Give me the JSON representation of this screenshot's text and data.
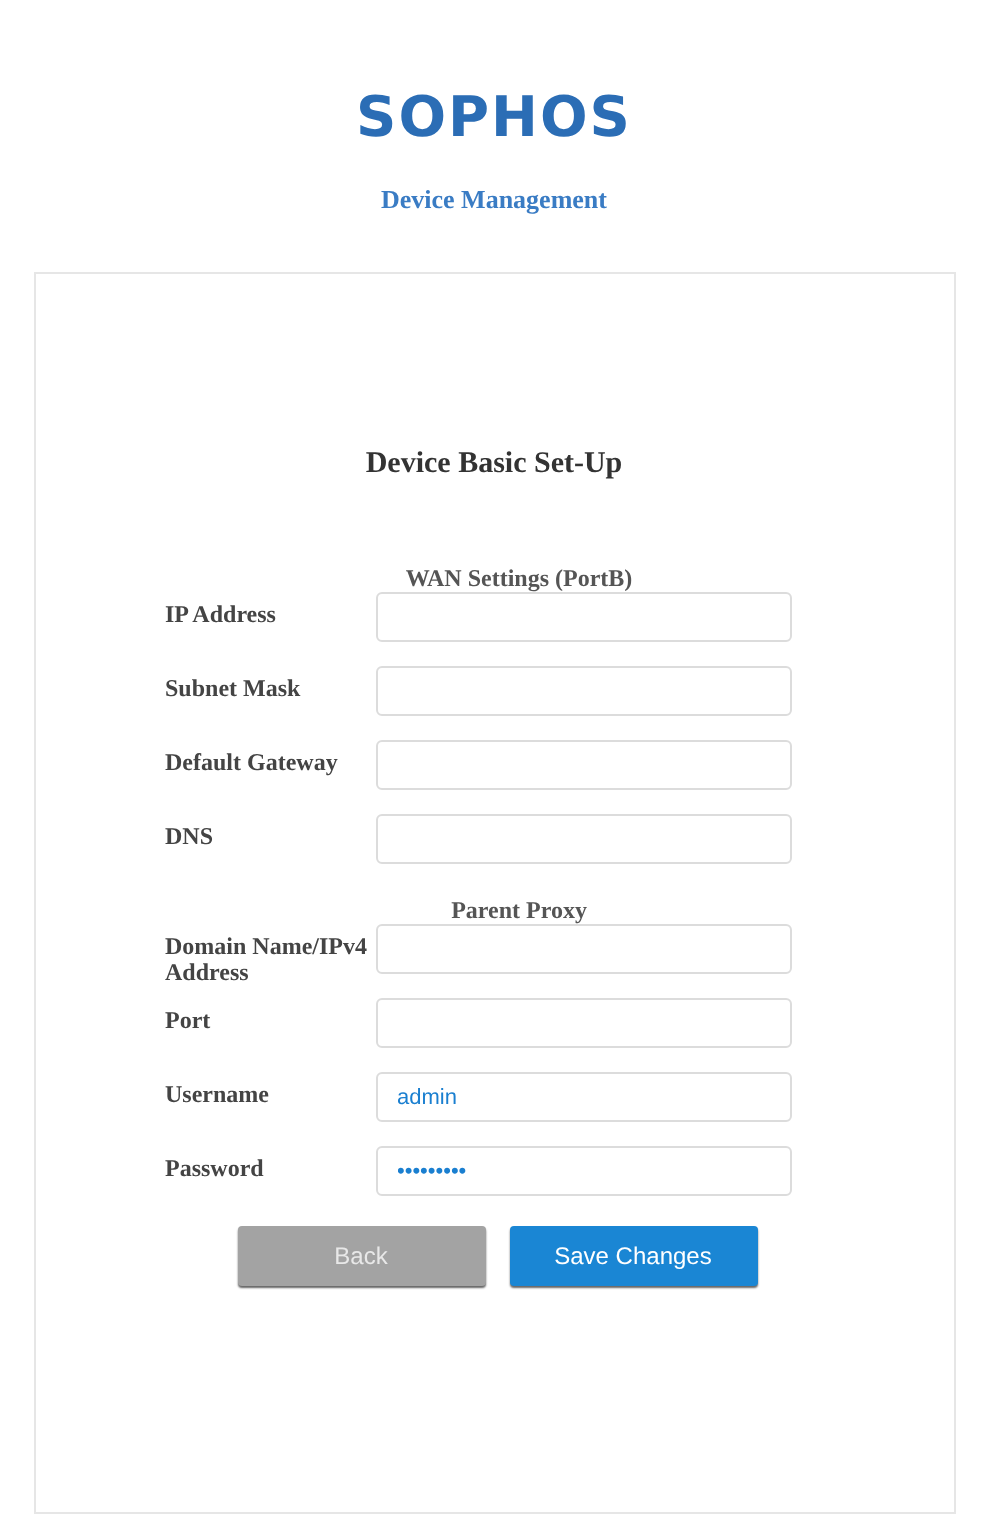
{
  "header": {
    "logo": "SOPHOS",
    "subtitle": "Device Management"
  },
  "form": {
    "title": "Device Basic Set-Up",
    "items": [
      {
        "kind": "heading",
        "text": "WAN Settings (PortB)"
      },
      {
        "kind": "field",
        "label": "IP Address"
      },
      {
        "kind": "field",
        "label": "Subnet Mask"
      },
      {
        "kind": "field",
        "label": "Default Gateway"
      },
      {
        "kind": "field",
        "label": "DNS"
      },
      {
        "kind": "heading",
        "text": "Parent Proxy"
      },
      {
        "kind": "field",
        "label": "Domain Name/IPv4 Address"
      },
      {
        "kind": "field",
        "label": "Port"
      },
      {
        "kind": "field",
        "label": "Username",
        "value": "admin"
      },
      {
        "kind": "field",
        "label": "Password",
        "value": "•••••••••"
      }
    ],
    "buttons": [
      {
        "label": "Back",
        "kind": "secondary"
      },
      {
        "label": "Save Changes",
        "kind": "primary"
      }
    ]
  }
}
